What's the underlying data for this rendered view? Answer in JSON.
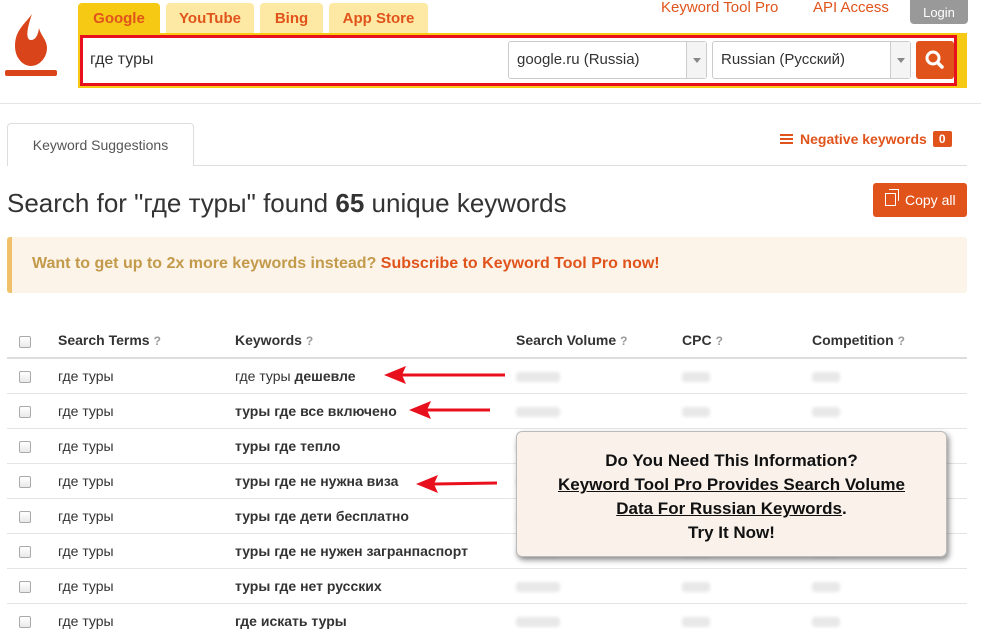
{
  "header": {
    "logo_icon": "flame-logo-icon",
    "tabs": [
      {
        "label": "Google",
        "active": true
      },
      {
        "label": "YouTube",
        "active": false
      },
      {
        "label": "Bing",
        "active": false
      },
      {
        "label": "App Store",
        "active": false
      }
    ],
    "links": {
      "pro": "Keyword Tool Pro",
      "api": "API Access",
      "login": "Login"
    }
  },
  "search": {
    "query": "где туры",
    "engine": "google.ru (Russia)",
    "language": "Russian (Русский)",
    "button_icon": "search-icon"
  },
  "results": {
    "tab_label": "Keyword Suggestions",
    "negative_label": "Negative keywords",
    "negative_count": "0",
    "headline_prefix": "Search for \"где туры\" found",
    "count": "65",
    "headline_suffix": "unique keywords",
    "copy_label": "Copy all"
  },
  "promo": {
    "text": "Want to get up to 2x more keywords instead?",
    "link": "Subscribe to Keyword Tool Pro now!"
  },
  "table": {
    "headers": {
      "terms": "Search Terms",
      "keywords": "Keywords",
      "volume": "Search Volume",
      "cpc": "CPC",
      "competition": "Competition",
      "help": "?"
    },
    "rows": [
      {
        "term": "где туры",
        "kw_plain": "где туры ",
        "kw_bold": "дешевле"
      },
      {
        "term": "где туры",
        "kw_plain": "",
        "kw_bold": "туры где все включено"
      },
      {
        "term": "где туры",
        "kw_plain": "",
        "kw_bold": "туры где тепло"
      },
      {
        "term": "где туры",
        "kw_plain": "",
        "kw_bold": "туры где не нужна виза"
      },
      {
        "term": "где туры",
        "kw_plain": "",
        "kw_bold": "туры где дети бесплатно"
      },
      {
        "term": "где туры",
        "kw_plain": "",
        "kw_bold": "туры где не нужен загранпаспорт"
      },
      {
        "term": "где туры",
        "kw_plain": "",
        "kw_bold": "туры где нет русских"
      },
      {
        "term": "где туры",
        "kw_plain": "",
        "kw_bold": "где искать туры"
      }
    ]
  },
  "popup": {
    "line1": "Do You Need This Information?",
    "line2": "Keyword Tool Pro Provides Search Volume",
    "line3": "Data For Russian Keywords",
    "line3_end": ".",
    "line4": "Try It Now!"
  },
  "annotation_color": "#e8101d",
  "accent_color": "#e0541c"
}
